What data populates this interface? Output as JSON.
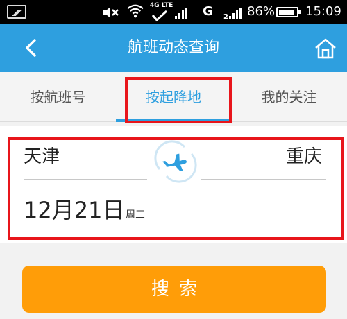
{
  "status_bar": {
    "network_type": "4G LTE",
    "carrier_letter": "G",
    "battery_percent": "86%",
    "battery_level": 0.86,
    "time": "15:09"
  },
  "header": {
    "title": "航班动态查询",
    "back_icon": "chevron-left-icon",
    "home_icon": "home-icon"
  },
  "tabs": [
    {
      "label": "按航班号",
      "active": false
    },
    {
      "label": "按起降地",
      "active": true
    },
    {
      "label": "我的关注",
      "active": false
    }
  ],
  "form": {
    "departure_city": "天津",
    "arrival_city": "重庆",
    "date": "12月21日",
    "weekday": "周三",
    "swap_icon": "airplane-swap-icon"
  },
  "search_button": {
    "label": "搜索"
  },
  "colors": {
    "header_bg": "#2e9fdf",
    "accent": "#2e9fdf",
    "search_button": "#ff9d08",
    "highlight_box": "#e8151b"
  }
}
